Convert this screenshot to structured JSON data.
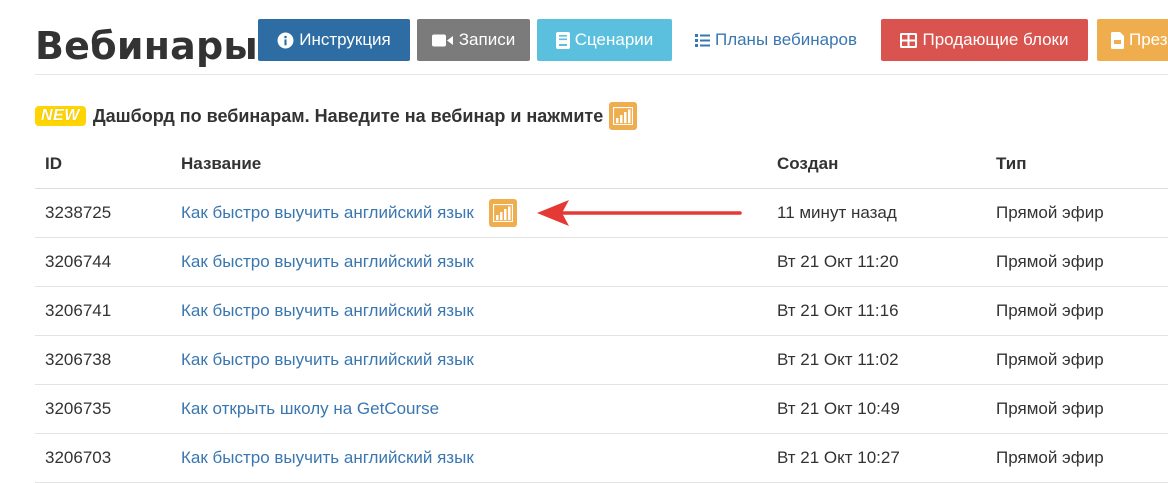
{
  "page": {
    "title": "Вебинары"
  },
  "toolbar": {
    "instruction_label": "Инструкция",
    "recordings_label": "Записи",
    "scenarios_label": "Сценарии",
    "plans_label": "Планы вебинаров",
    "selling_blocks_label": "Продающие блоки",
    "presentations_label": "През"
  },
  "notice": {
    "badge": "NEW",
    "text": "Дашборд по вебинарам. Наведите на вебинар и нажмите"
  },
  "table": {
    "columns": {
      "id": "ID",
      "name": "Название",
      "created": "Создан",
      "type": "Тип"
    },
    "rows": [
      {
        "id": "3238725",
        "name": "Как быстро выучить английский язык",
        "created": "11 минут назад",
        "type": "Прямой эфир"
      },
      {
        "id": "3206744",
        "name": "Как быстро выучить английский язык",
        "created": "Вт 21 Окт 11:20",
        "type": "Прямой эфир"
      },
      {
        "id": "3206741",
        "name": "Как быстро выучить английский язык",
        "created": "Вт 21 Окт 11:16",
        "type": "Прямой эфир"
      },
      {
        "id": "3206738",
        "name": "Как быстро выучить английский язык",
        "created": "Вт 21 Окт 11:02",
        "type": "Прямой эфир"
      },
      {
        "id": "3206735",
        "name": "Как открыть школу на GetCourse",
        "created": "Вт 21 Окт 10:49",
        "type": "Прямой эфир"
      },
      {
        "id": "3206703",
        "name": "Как быстро выучить английский язык",
        "created": "Вт 21 Окт 10:27",
        "type": "Прямой эфир"
      }
    ]
  },
  "icons": {
    "instruction": "info-circle-icon",
    "recordings": "video-camera-icon",
    "scenarios": "book-icon",
    "plans": "list-icon",
    "selling_blocks": "table-grid-icon",
    "presentations": "file-icon",
    "dashboard": "bar-chart-icon",
    "annotation": "red-arrow-icon"
  },
  "colors": {
    "primary": "#2e6da4",
    "gray": "#7b7b7b",
    "info": "#5bc0de",
    "danger": "#d9534f",
    "warning": "#f0ad4e",
    "link": "#3a77b0",
    "new_badge": "#ffd400",
    "arrow": "#e53935"
  }
}
